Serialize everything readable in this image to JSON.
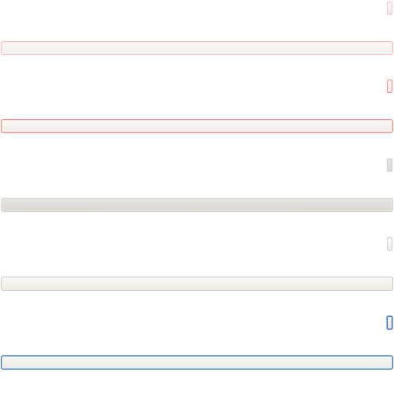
{
  "controls": [
    {
      "state": "hover",
      "border_color": "#efc2bf",
      "accent_color": "#f1c9c6"
    },
    {
      "state": "error",
      "border_color": "#f08a86",
      "accent_color": "#ef8e8a"
    },
    {
      "state": "disabled",
      "border_color": "#d4d1cd",
      "accent_color": "#d2d0cc"
    },
    {
      "state": "normal",
      "border_color": "#cbc8c0",
      "accent_color": "#d2cfc8"
    },
    {
      "state": "focused",
      "border_color": "#2f69bc",
      "accent_color": "#2c66b8"
    }
  ],
  "colors": {
    "background": "#ffffff",
    "focus_blue": "#2f69bc",
    "error_red": "#f08a86",
    "neutral_border": "#cbc8c0"
  }
}
